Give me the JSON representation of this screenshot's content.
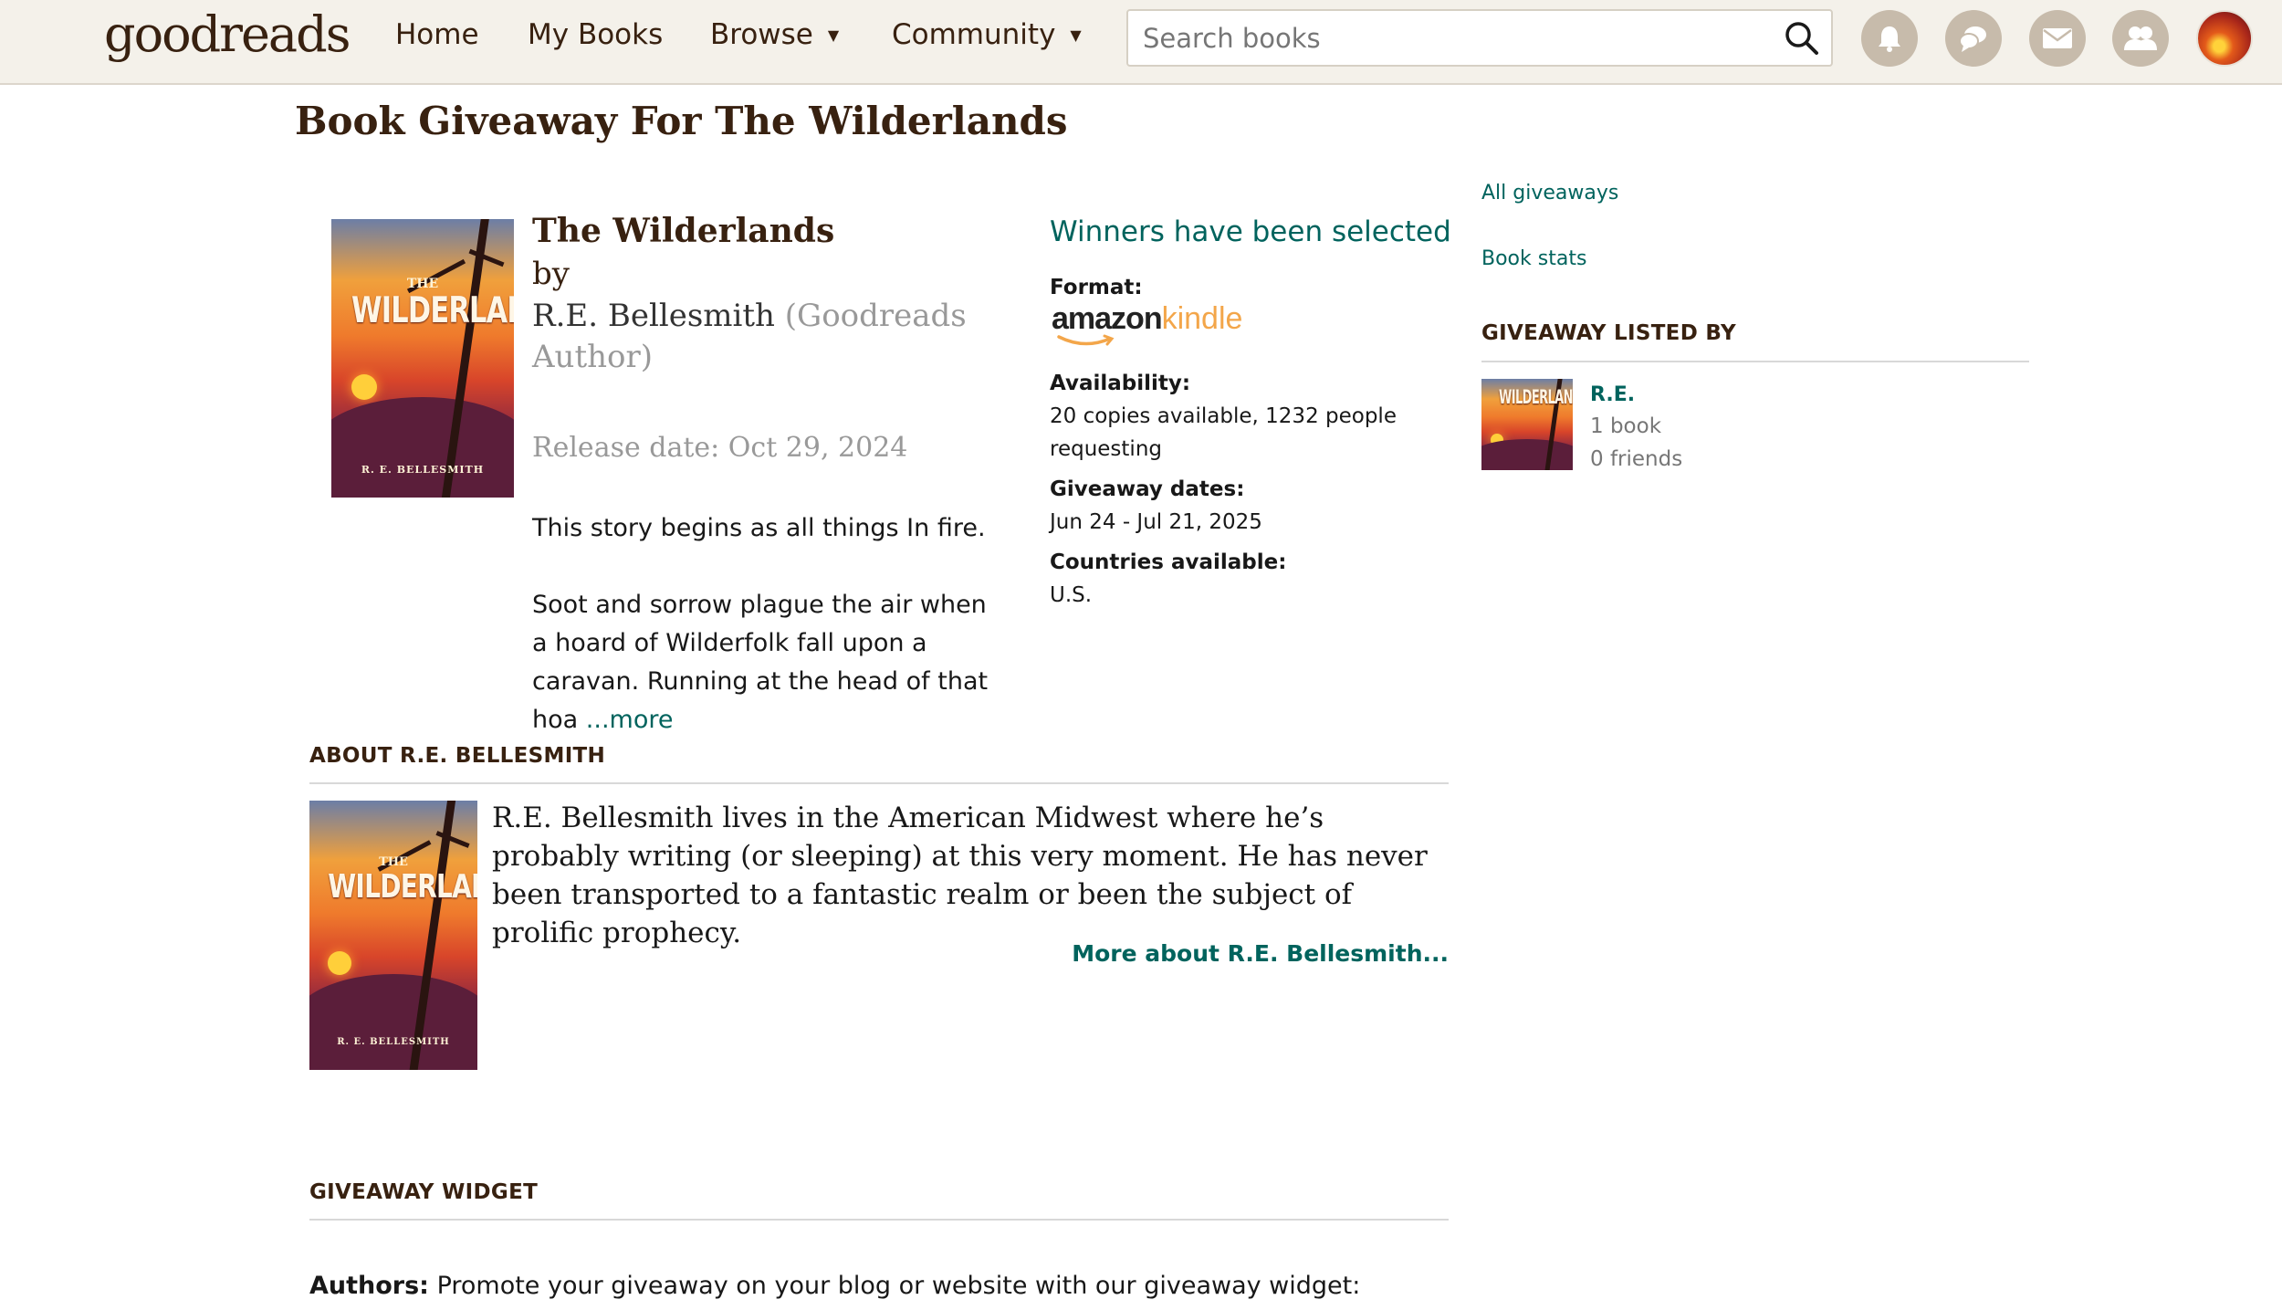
{
  "header": {
    "logo": "goodreads",
    "nav": [
      "Home",
      "My Books",
      "Browse",
      "Community"
    ],
    "search_placeholder": "Search books",
    "icons": [
      "search-icon",
      "notifications-icon",
      "discussions-icon",
      "messages-icon",
      "friends-icon",
      "profile-avatar"
    ]
  },
  "page": {
    "title": "Book Giveaway For The Wilderlands"
  },
  "book": {
    "title": "The Wilderlands",
    "by": "by",
    "author": "R.E. Bellesmith",
    "author_role": "(Goodreads Author)",
    "release": "Release date: Oct 29, 2024",
    "description_p1": "This story begins as all things In fire.",
    "description_p2": "Soot and sorrow plague the air when a hoard of Wilderfolk fall upon a caravan. Running at the head of that hoa",
    "more_link": "...more",
    "cover": {
      "small_title": "THE",
      "big_title": "WILDERLANDS",
      "author": "R. E. BELLESMITH"
    }
  },
  "giveaway": {
    "status": "Winners have been selected",
    "format_label": "Format:",
    "format_logo_amazon": "amazon",
    "format_logo_kindle": "kindle",
    "availability_label": "Availability:",
    "availability_value": "20 copies available, 1232 people requesting",
    "dates_label": "Giveaway dates:",
    "dates_value": "Jun 24 - Jul 21, 2025",
    "countries_label": "Countries available:",
    "countries_value": "U.S."
  },
  "sidebar": {
    "all_giveaways": "All giveaways",
    "book_stats": "Book stats",
    "listed_by_heading": "GIVEAWAY LISTED BY",
    "lister_name": "R.E.",
    "lister_books": "1 book",
    "lister_friends": "0 friends"
  },
  "about": {
    "heading": "ABOUT R.E. BELLESMITH",
    "bio": "R.E. Bellesmith lives in the American Midwest where he’s probably writing (or sleeping) at this very moment. He has never been transported to a fantastic realm or been the subject of prolific prophecy.",
    "more_link": "More about R.E. Bellesmith..."
  },
  "widget": {
    "heading": "GIVEAWAY WIDGET",
    "authors_label": "Authors:",
    "authors_text": " Promote your giveaway on your blog or website with our giveaway widget:"
  },
  "colors": {
    "header_bg": "#f4f1ea",
    "brand_brown": "#382110",
    "link_green": "#00635d",
    "icon_circle": "#c7bbab"
  }
}
